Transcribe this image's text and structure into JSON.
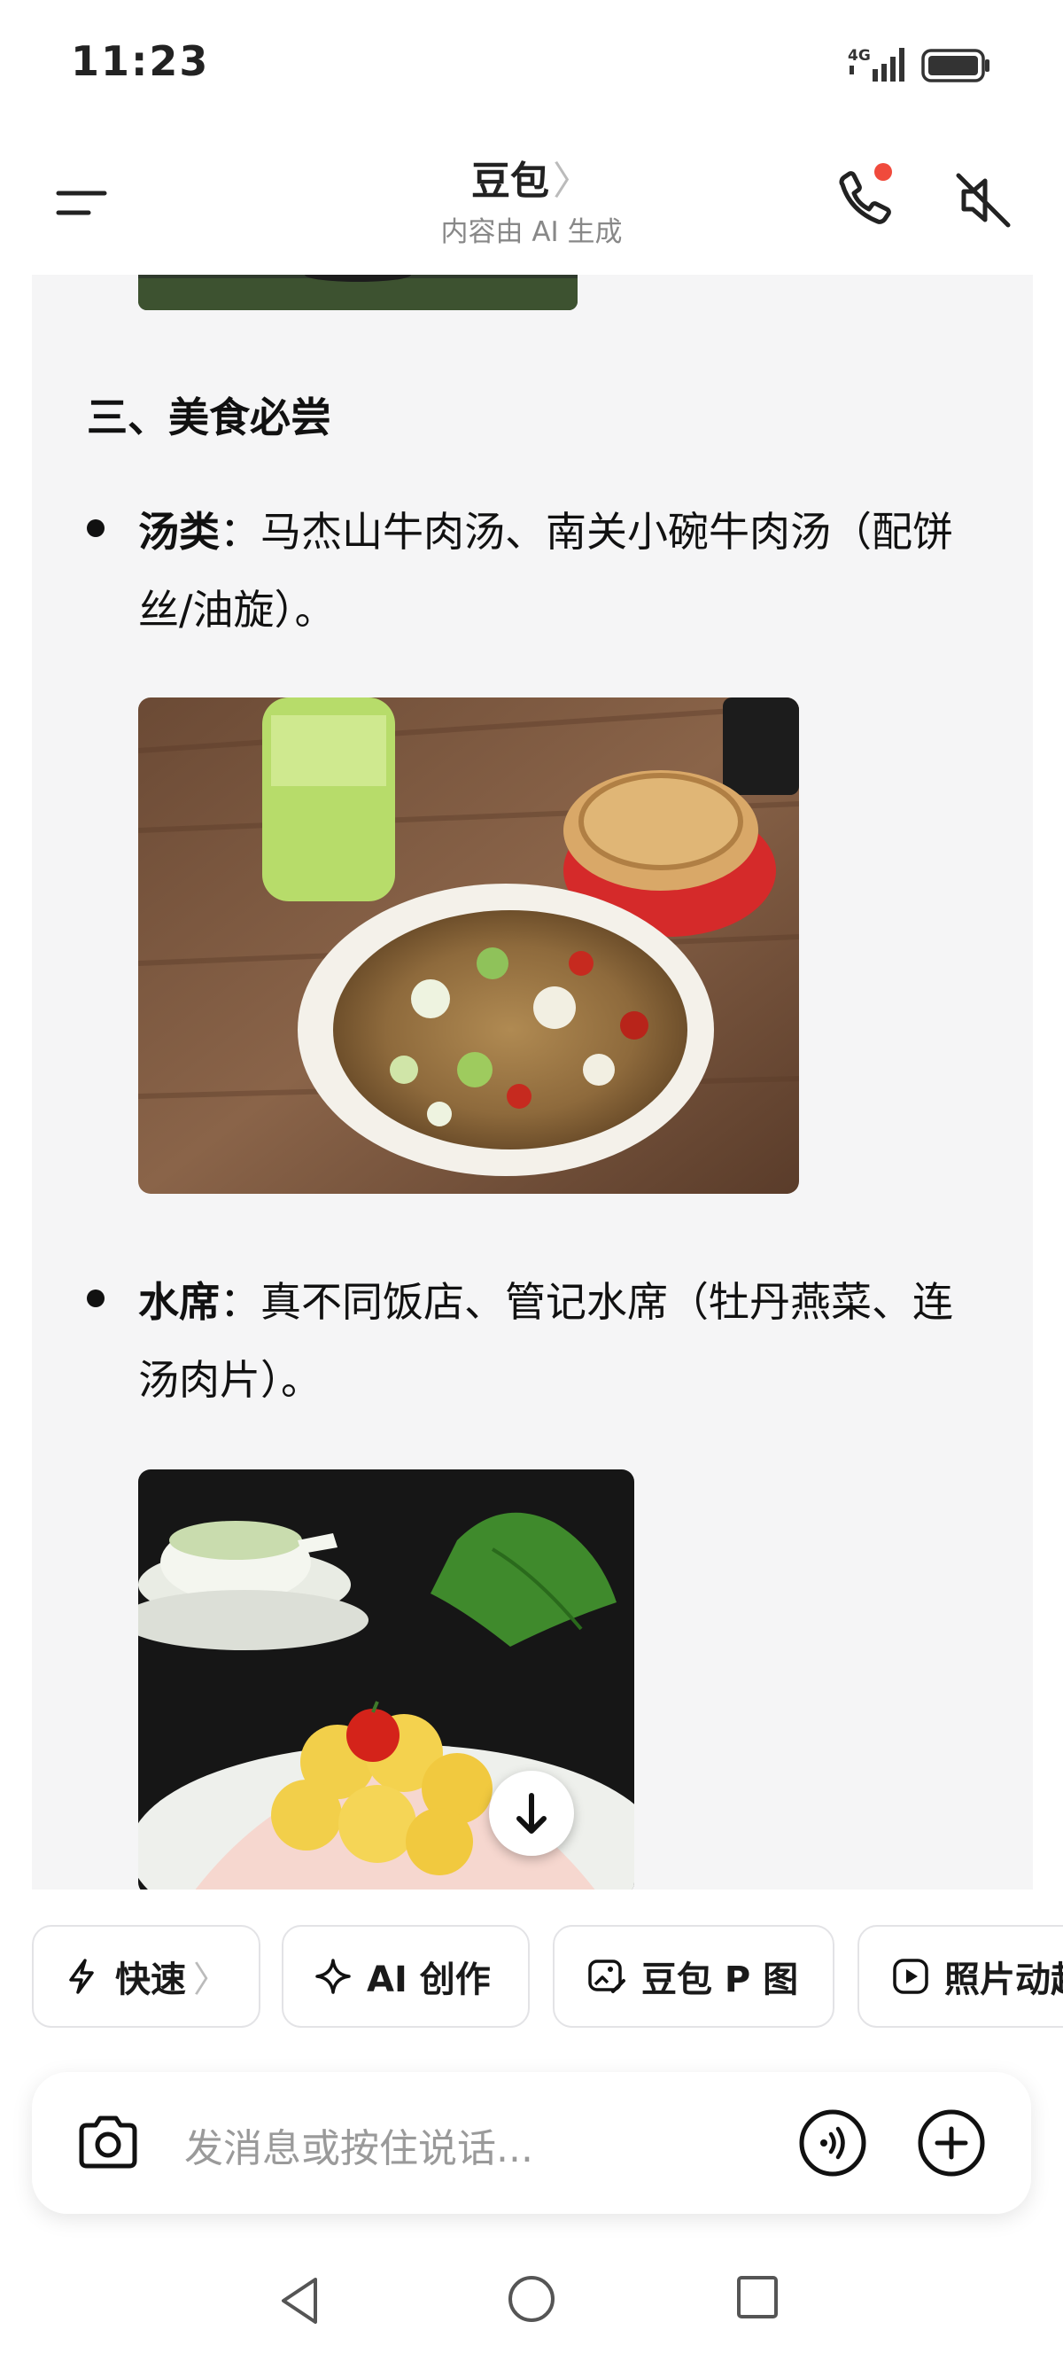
{
  "status_bar": {
    "time": "11:23",
    "network": "4G",
    "network_icon": "signal-icon",
    "battery_icon": "battery-icon"
  },
  "header": {
    "title": "豆包",
    "title_chevron": "〉",
    "subtitle": "内容由 AI 生成",
    "menu_icon": "menu-icon",
    "call_icon": "phone-icon",
    "call_badge_color": "#f04a3c",
    "mute_icon": "speaker-muted-icon"
  },
  "content": {
    "section_heading": "三、美食必尝",
    "items": [
      {
        "label": "汤类",
        "separator": "：",
        "text": "马杰山牛肉汤、南关小碗牛肉汤（配饼丝/油旋）。",
        "image": "soup-photo"
      },
      {
        "label": "水席",
        "separator": "：",
        "text": "真不同饭店、管记水席（牡丹燕菜、连汤肉片）。",
        "image": "banquet-dish-photo"
      }
    ],
    "scroll_button_icon": "arrow-down-icon"
  },
  "quick_actions": [
    {
      "label": "快速",
      "icon": "lightning-icon",
      "chevron": "〉"
    },
    {
      "label": "AI 创作",
      "icon": "sparkle-icon"
    },
    {
      "label": "豆包 P 图",
      "icon": "image-edit-icon"
    },
    {
      "label": "照片动起来",
      "icon": "play-icon"
    }
  ],
  "input": {
    "placeholder": "发消息或按住说话...",
    "camera_icon": "camera-icon",
    "voice_icon": "voice-icon",
    "plus_icon": "plus-icon"
  },
  "system_nav": {
    "back": "back-icon",
    "home": "home-icon",
    "recent": "recent-apps-icon"
  },
  "colors": {
    "content_bg": "#f5f5f6",
    "text": "#111111",
    "muted_text": "#888888",
    "chip_border": "#e3e3e6",
    "badge_red": "#f04a3c"
  }
}
